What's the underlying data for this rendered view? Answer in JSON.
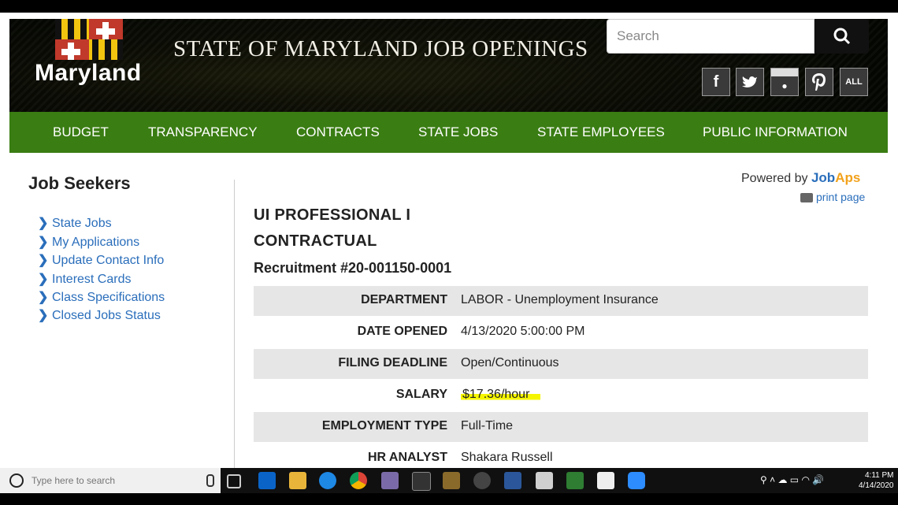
{
  "site": {
    "logo_text": "Maryland",
    "title": "STATE OF MARYLAND JOB OPENINGS"
  },
  "search": {
    "placeholder": "Search"
  },
  "social": [
    {
      "icon": "facebook-icon",
      "glyph": "f"
    },
    {
      "icon": "twitter-icon",
      "glyph": "🐦"
    },
    {
      "icon": "instagram-icon",
      "glyph": "●"
    },
    {
      "icon": "pinterest-icon",
      "glyph": "P"
    },
    {
      "icon": "all-social-icon",
      "glyph": "ALL"
    }
  ],
  "nav": [
    "BUDGET",
    "TRANSPARENCY",
    "CONTRACTS",
    "STATE JOBS",
    "STATE EMPLOYEES",
    "PUBLIC INFORMATION"
  ],
  "sidebar": {
    "title": "Job Seekers",
    "links": [
      "State Jobs",
      "My Applications",
      "Update Contact Info",
      "Interest Cards",
      "Class Specifications",
      "Closed Jobs Status"
    ]
  },
  "powered": {
    "label": "Powered by",
    "brand_a": "Job",
    "brand_b": "Aps",
    "print": "print page"
  },
  "job": {
    "title_line1": "UI PROFESSIONAL I",
    "title_line2": "CONTRACTUAL",
    "recruitment": "Recruitment #20-001150-0001",
    "details": [
      {
        "label": "DEPARTMENT",
        "value": "LABOR - Unemployment Insurance"
      },
      {
        "label": "DATE OPENED",
        "value": "4/13/2020 5:00:00 PM"
      },
      {
        "label": "FILING DEADLINE",
        "value": "Open/Continuous"
      },
      {
        "label": "SALARY",
        "value": "$17.36/hour"
      },
      {
        "label": "EMPLOYMENT TYPE",
        "value": "Full-Time"
      },
      {
        "label": "HR ANALYST",
        "value": "Shakara Russell"
      }
    ]
  },
  "taskbar": {
    "search_placeholder": "Type here to search",
    "time": "4:11 PM",
    "date": "4/14/2020"
  },
  "colors": {
    "nav_green": "#3a7d13",
    "link_blue": "#2a6ebb",
    "highlight": "#f5f500"
  }
}
